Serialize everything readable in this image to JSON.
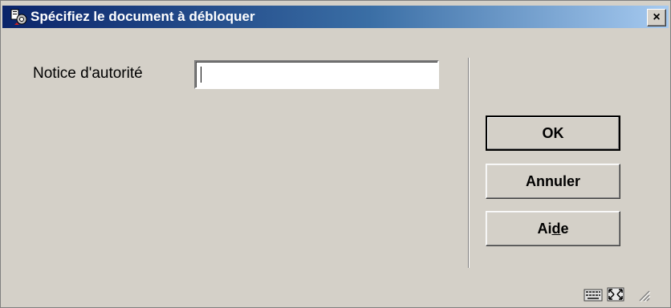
{
  "window": {
    "title": "Spécifiez le document à débloquer",
    "close_label": "×"
  },
  "form": {
    "field_label": "Notice d'autorité",
    "field_value": ""
  },
  "buttons": {
    "ok_label": "OK",
    "cancel_label": "Annuler",
    "help_label_prefix": "Ai",
    "help_label_underlined": "d",
    "help_label_suffix": "e"
  },
  "icons": {
    "title_icon": "app-icon",
    "status_icon_1": "keyboard-icon",
    "status_icon_2": "resize-icon",
    "status_icon_3": "size-grip-icon"
  }
}
